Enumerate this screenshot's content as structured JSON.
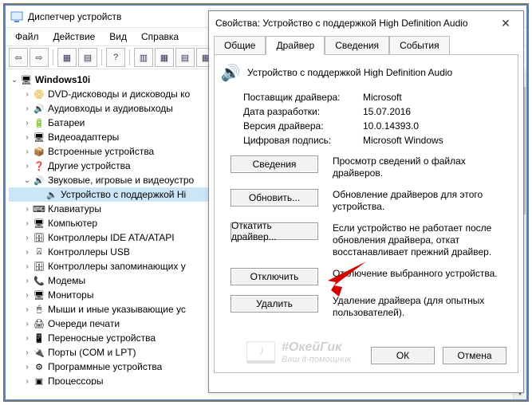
{
  "main_window": {
    "title": "Диспетчер устройств",
    "menu": {
      "file": "Файл",
      "action": "Действие",
      "view": "Вид",
      "help": "Справка"
    },
    "toolbar": {
      "back_icon": "⇦",
      "fwd_icon": "⇨",
      "btns": [
        "▦",
        "▤",
        "?",
        "▥",
        "▦",
        "▤",
        "▦"
      ],
      "close_x": "✖"
    }
  },
  "tree": {
    "root": "Windows10i",
    "items": [
      {
        "label": "DVD-дисководы и дисководы ко",
        "icon": "📀",
        "twist": "›"
      },
      {
        "label": "Аудиовходы и аудиовыходы",
        "icon": "🔊",
        "twist": "›"
      },
      {
        "label": "Батареи",
        "icon": "🔋",
        "twist": "›"
      },
      {
        "label": "Видеоадаптеры",
        "icon": "🖥",
        "twist": "›"
      },
      {
        "label": "Встроенные устройства",
        "icon": "📦",
        "twist": "›"
      },
      {
        "label": "Другие устройства",
        "icon": "❓",
        "twist": "›"
      },
      {
        "label": "Звуковые, игровые и видеоустро",
        "icon": "🔊",
        "twist": "⌄",
        "expanded": true,
        "children": [
          {
            "label": "Устройство с поддержкой Hi",
            "icon": "🔈"
          }
        ]
      },
      {
        "label": "Клавиатуры",
        "icon": "⌨",
        "twist": "›"
      },
      {
        "label": "Компьютер",
        "icon": "🖥",
        "twist": "›"
      },
      {
        "label": "Контроллеры IDE ATA/ATAPI",
        "icon": "🗄",
        "twist": "›"
      },
      {
        "label": "Контроллеры USB",
        "icon": "⍓",
        "twist": "›"
      },
      {
        "label": "Контроллеры запоминающих у",
        "icon": "🗄",
        "twist": "›"
      },
      {
        "label": "Модемы",
        "icon": "📞",
        "twist": "›"
      },
      {
        "label": "Мониторы",
        "icon": "🖥",
        "twist": "›"
      },
      {
        "label": "Мыши и иные указывающие ус",
        "icon": "🖱",
        "twist": "›"
      },
      {
        "label": "Очереди печати",
        "icon": "🖨",
        "twist": "›"
      },
      {
        "label": "Переносные устройства",
        "icon": "📱",
        "twist": "›"
      },
      {
        "label": "Порты (COM и LPT)",
        "icon": "🔌",
        "twist": "›"
      },
      {
        "label": "Программные устройства",
        "icon": "⚙",
        "twist": "›"
      },
      {
        "label": "Процессоры",
        "icon": "▣",
        "twist": "›"
      }
    ]
  },
  "dialog": {
    "title": "Свойства: Устройство с поддержкой High Definition Audio",
    "close": "✕",
    "tabs": {
      "general": "Общие",
      "driver": "Драйвер",
      "details": "Сведения",
      "events": "События"
    },
    "device_name": "Устройство с поддержкой High Definition Audio",
    "kv": {
      "provider_k": "Поставщик драйвера:",
      "provider_v": "Microsoft",
      "date_k": "Дата разработки:",
      "date_v": "15.07.2016",
      "version_k": "Версия драйвера:",
      "version_v": "10.0.14393.0",
      "sign_k": "Цифровая подпись:",
      "sign_v": "Microsoft Windows"
    },
    "buttons": {
      "details": {
        "label": "Сведения",
        "desc": "Просмотр сведений о файлах драйверов."
      },
      "update": {
        "label": "Обновить...",
        "desc": "Обновление драйверов для этого устройства."
      },
      "rollback": {
        "label": "Откатить драйвер...",
        "desc": "Если устройство не работает после обновления драйвера, откат восстанавливает прежний драйвер."
      },
      "disable": {
        "label": "Отключить",
        "desc": "Отключение выбранного устройства."
      },
      "delete": {
        "label": "Удалить",
        "desc": "Удаление драйвера (для опытных пользователей)."
      }
    },
    "ok": "ОК",
    "cancel": "Отмена"
  },
  "watermark": {
    "brand": "#ОкейГик",
    "tag": "Ваш it-помощник",
    "icon": ":)"
  }
}
